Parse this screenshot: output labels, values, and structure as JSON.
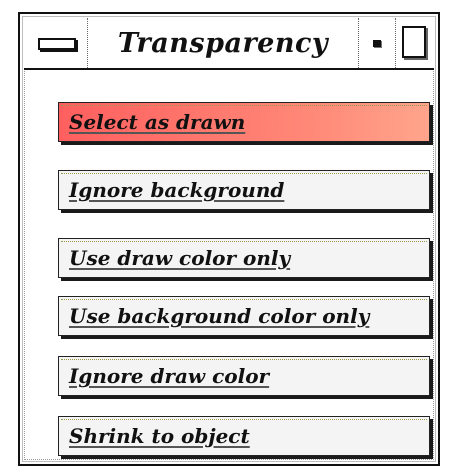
{
  "window": {
    "title": "Transparency"
  },
  "icons": {
    "menu": "window-menu-icon",
    "minimize": "minimize-icon",
    "maximize": "maximize-icon"
  },
  "options": [
    {
      "label": "Select as drawn",
      "selected": true
    },
    {
      "label": "Ignore background",
      "selected": false
    },
    {
      "label": "Use draw color only",
      "selected": false
    },
    {
      "label": "Use background color only",
      "selected": false
    },
    {
      "label": "Ignore draw color",
      "selected": false
    },
    {
      "label": "Shrink to object",
      "selected": false
    }
  ],
  "colors": {
    "selected_button": "#ff6a6a",
    "button": "#f4f4f4",
    "border": "#111111"
  }
}
